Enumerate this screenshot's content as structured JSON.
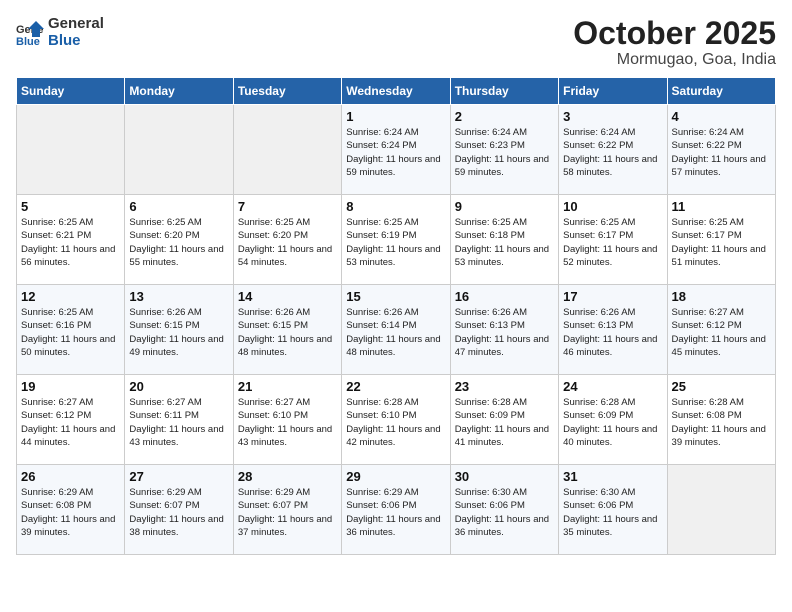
{
  "header": {
    "logo_general": "General",
    "logo_blue": "Blue",
    "title": "October 2025",
    "subtitle": "Mormugao, Goa, India"
  },
  "weekdays": [
    "Sunday",
    "Monday",
    "Tuesday",
    "Wednesday",
    "Thursday",
    "Friday",
    "Saturday"
  ],
  "weeks": [
    [
      {
        "day": "",
        "empty": true
      },
      {
        "day": "",
        "empty": true
      },
      {
        "day": "",
        "empty": true
      },
      {
        "day": "1",
        "sunrise": "6:24 AM",
        "sunset": "6:24 PM",
        "daylight": "11 hours and 59 minutes."
      },
      {
        "day": "2",
        "sunrise": "6:24 AM",
        "sunset": "6:23 PM",
        "daylight": "11 hours and 59 minutes."
      },
      {
        "day": "3",
        "sunrise": "6:24 AM",
        "sunset": "6:22 PM",
        "daylight": "11 hours and 58 minutes."
      },
      {
        "day": "4",
        "sunrise": "6:24 AM",
        "sunset": "6:22 PM",
        "daylight": "11 hours and 57 minutes."
      }
    ],
    [
      {
        "day": "5",
        "sunrise": "6:25 AM",
        "sunset": "6:21 PM",
        "daylight": "11 hours and 56 minutes."
      },
      {
        "day": "6",
        "sunrise": "6:25 AM",
        "sunset": "6:20 PM",
        "daylight": "11 hours and 55 minutes."
      },
      {
        "day": "7",
        "sunrise": "6:25 AM",
        "sunset": "6:20 PM",
        "daylight": "11 hours and 54 minutes."
      },
      {
        "day": "8",
        "sunrise": "6:25 AM",
        "sunset": "6:19 PM",
        "daylight": "11 hours and 53 minutes."
      },
      {
        "day": "9",
        "sunrise": "6:25 AM",
        "sunset": "6:18 PM",
        "daylight": "11 hours and 53 minutes."
      },
      {
        "day": "10",
        "sunrise": "6:25 AM",
        "sunset": "6:17 PM",
        "daylight": "11 hours and 52 minutes."
      },
      {
        "day": "11",
        "sunrise": "6:25 AM",
        "sunset": "6:17 PM",
        "daylight": "11 hours and 51 minutes."
      }
    ],
    [
      {
        "day": "12",
        "sunrise": "6:25 AM",
        "sunset": "6:16 PM",
        "daylight": "11 hours and 50 minutes."
      },
      {
        "day": "13",
        "sunrise": "6:26 AM",
        "sunset": "6:15 PM",
        "daylight": "11 hours and 49 minutes."
      },
      {
        "day": "14",
        "sunrise": "6:26 AM",
        "sunset": "6:15 PM",
        "daylight": "11 hours and 48 minutes."
      },
      {
        "day": "15",
        "sunrise": "6:26 AM",
        "sunset": "6:14 PM",
        "daylight": "11 hours and 48 minutes."
      },
      {
        "day": "16",
        "sunrise": "6:26 AM",
        "sunset": "6:13 PM",
        "daylight": "11 hours and 47 minutes."
      },
      {
        "day": "17",
        "sunrise": "6:26 AM",
        "sunset": "6:13 PM",
        "daylight": "11 hours and 46 minutes."
      },
      {
        "day": "18",
        "sunrise": "6:27 AM",
        "sunset": "6:12 PM",
        "daylight": "11 hours and 45 minutes."
      }
    ],
    [
      {
        "day": "19",
        "sunrise": "6:27 AM",
        "sunset": "6:12 PM",
        "daylight": "11 hours and 44 minutes."
      },
      {
        "day": "20",
        "sunrise": "6:27 AM",
        "sunset": "6:11 PM",
        "daylight": "11 hours and 43 minutes."
      },
      {
        "day": "21",
        "sunrise": "6:27 AM",
        "sunset": "6:10 PM",
        "daylight": "11 hours and 43 minutes."
      },
      {
        "day": "22",
        "sunrise": "6:28 AM",
        "sunset": "6:10 PM",
        "daylight": "11 hours and 42 minutes."
      },
      {
        "day": "23",
        "sunrise": "6:28 AM",
        "sunset": "6:09 PM",
        "daylight": "11 hours and 41 minutes."
      },
      {
        "day": "24",
        "sunrise": "6:28 AM",
        "sunset": "6:09 PM",
        "daylight": "11 hours and 40 minutes."
      },
      {
        "day": "25",
        "sunrise": "6:28 AM",
        "sunset": "6:08 PM",
        "daylight": "11 hours and 39 minutes."
      }
    ],
    [
      {
        "day": "26",
        "sunrise": "6:29 AM",
        "sunset": "6:08 PM",
        "daylight": "11 hours and 39 minutes."
      },
      {
        "day": "27",
        "sunrise": "6:29 AM",
        "sunset": "6:07 PM",
        "daylight": "11 hours and 38 minutes."
      },
      {
        "day": "28",
        "sunrise": "6:29 AM",
        "sunset": "6:07 PM",
        "daylight": "11 hours and 37 minutes."
      },
      {
        "day": "29",
        "sunrise": "6:29 AM",
        "sunset": "6:06 PM",
        "daylight": "11 hours and 36 minutes."
      },
      {
        "day": "30",
        "sunrise": "6:30 AM",
        "sunset": "6:06 PM",
        "daylight": "11 hours and 36 minutes."
      },
      {
        "day": "31",
        "sunrise": "6:30 AM",
        "sunset": "6:06 PM",
        "daylight": "11 hours and 35 minutes."
      },
      {
        "day": "",
        "empty": true
      }
    ]
  ],
  "labels": {
    "sunrise": "Sunrise:",
    "sunset": "Sunset:",
    "daylight": "Daylight hours"
  }
}
